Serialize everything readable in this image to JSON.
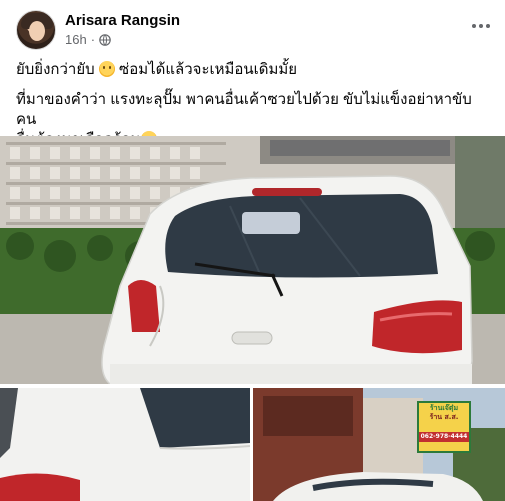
{
  "post": {
    "author": "Arisara Rangsin",
    "timestamp": "16h",
    "separator": "·",
    "audience_icon": "globe-icon",
    "more_icon": "more-horizontal-icon",
    "line1_a": "ยับยิ่งกว่ายับ ",
    "line1_b": " ซ่อมได้แล้วจะเหมือนเดิมมั้ย",
    "line2": "ที่มาของคำว่า แรงทะลุปั๊ม พาคนอื่นเค้าซวยไปด้วย ขับไม่แข็งอย่าหาขับ คน\nอื่นต้องมาเดือดร้อน",
    "emoji_1": "pleading-face-emoji",
    "emoji_2": "sad-face-emoji"
  },
  "photos": {
    "sign_line1": "ร้านเจ๊ตุ๋ม",
    "sign_line2": "ร้าน ส.ส.",
    "sign_phone": "062-978-4444"
  },
  "colors": {
    "name": "#050505",
    "meta": "#65676b",
    "car_white": "#f3f3f1",
    "window": "#2f3a45",
    "tail_light": "#c0262a",
    "hedge": "#3f6b2c"
  }
}
